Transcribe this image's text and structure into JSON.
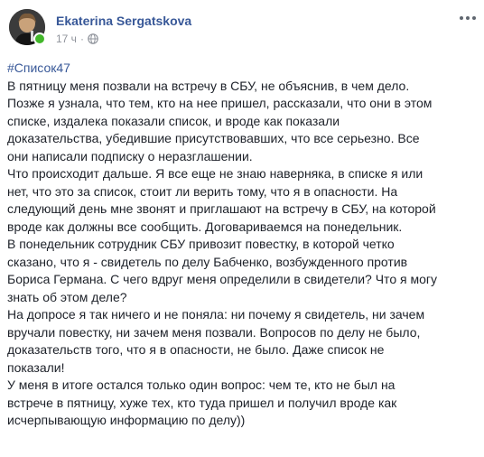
{
  "post": {
    "author": "Ekaterina Sergatskova",
    "time": "17 ч",
    "dot": "·",
    "hashtag": "#Список47",
    "paragraphs": [
      "В пятницу меня позвали на встречу в СБУ, не объяснив, в чем дело.\nПозже я узнала, что тем, кто на нее пришел, рассказали, что они в этом\nсписке, издалека показали список, и вроде как показали\nдоказательства, убедившие присутствовавших, что все серьезно. Все\nони написали подписку о неразглашении.",
      "Что происходит дальше. Я все еще не знаю наверняка, в списке я или\nнет, что это за список, стоит ли верить тому, что я в опасности. На\nследующий день мне звонят и приглашают на встречу в СБУ, на которой\nвроде как должны все сообщить. Договариваемся на понедельник.",
      "В понедельник сотрудник СБУ привозит повестку, в которой четко\nсказано, что я - свидетель по делу Бабченко, возбужденного против\nБориса Германа. С чего вдруг меня определили в свидетели? Что я могу\nзнать об этом деле?",
      "На допросе я так ничего и не поняла: ни почему я свидетель, ни зачем\nвручали повестку, ни зачем меня позвали. Вопросов по делу не было,\nдоказательств того, что я в опасности, не было. Даже список не\nпоказали!",
      "У меня в итоге остался только один вопрос: чем те, кто не был на\nвстрече в пятницу, хуже тех, кто туда пришел и получил вроде как\nисчерпывающую информацию по делу))"
    ]
  }
}
